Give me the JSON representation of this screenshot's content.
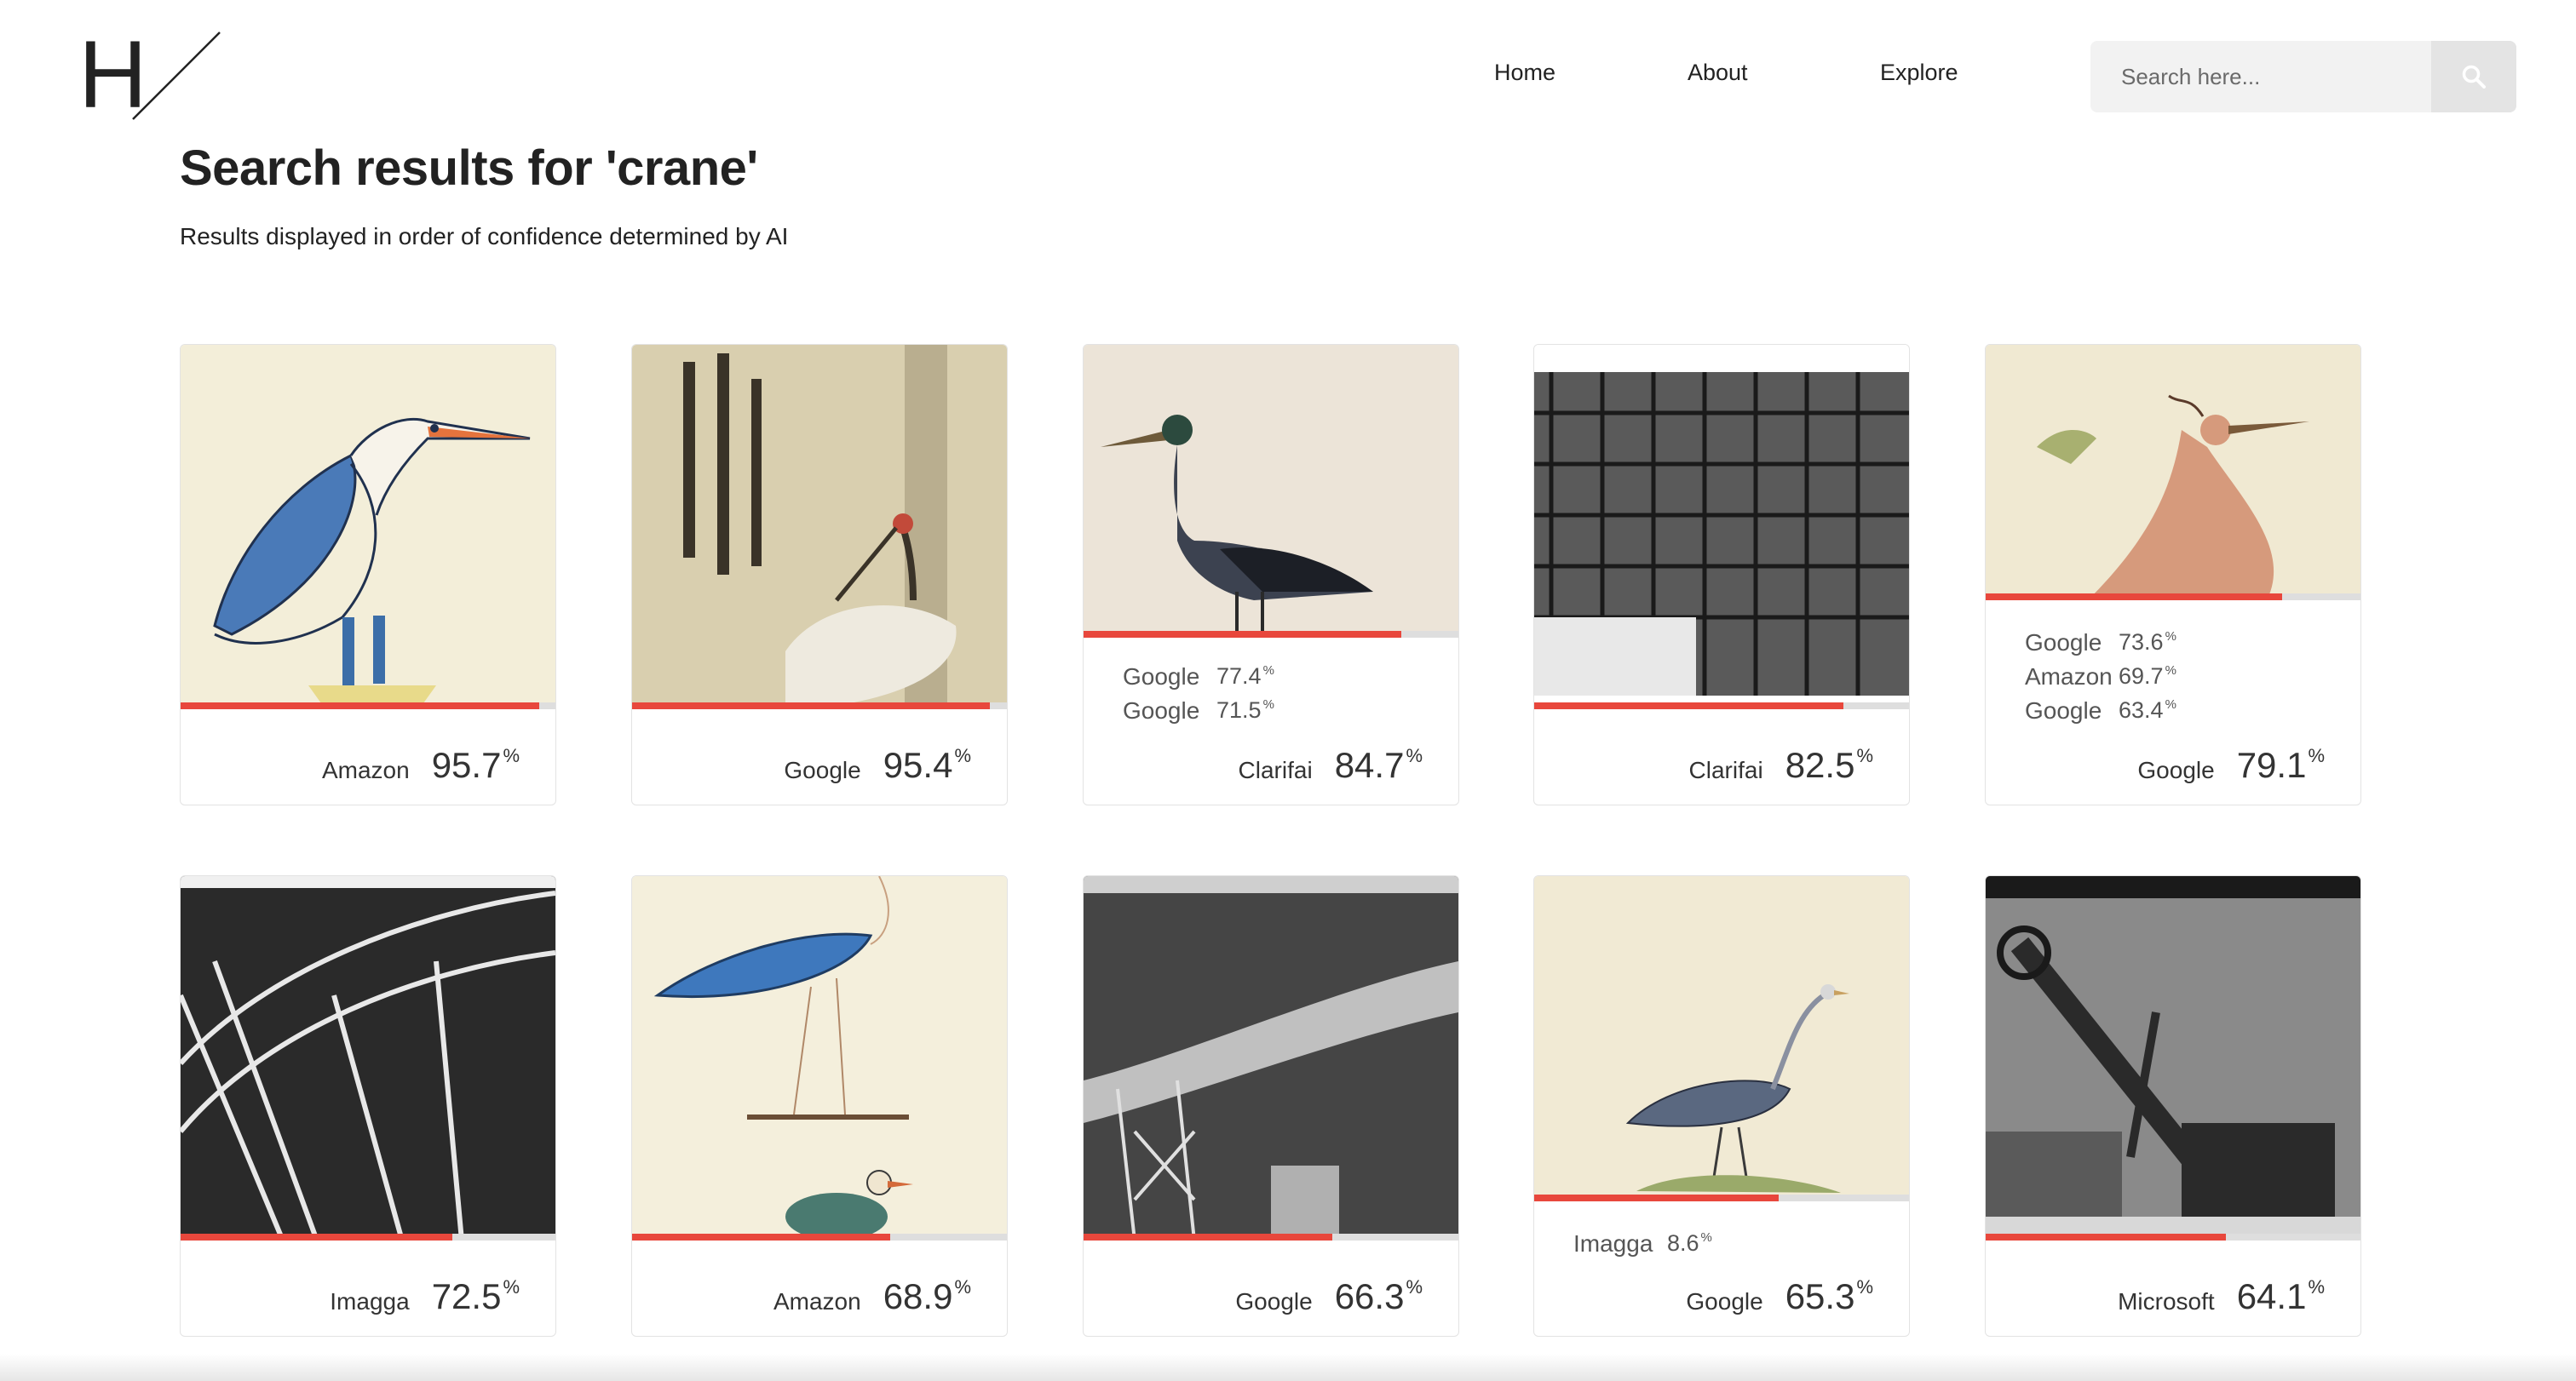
{
  "logo": {
    "letter": "H"
  },
  "nav": {
    "home": "Home",
    "about": "About",
    "explore": "Explore"
  },
  "search": {
    "placeholder": "Search here..."
  },
  "header": {
    "title": "Search results for 'crane'",
    "subtitle": "Results displayed in order of confidence determined by AI"
  },
  "percent_sign": "%",
  "results": [
    {
      "provider": "Amazon",
      "score": "95.7",
      "fill": 0.957,
      "extras": []
    },
    {
      "provider": "Google",
      "score": "95.4",
      "fill": 0.954,
      "extras": []
    },
    {
      "provider": "Clarifai",
      "score": "84.7",
      "fill": 0.847,
      "extras": [
        {
          "provider": "Google",
          "score": "77.4"
        },
        {
          "provider": "Google",
          "score": "71.5"
        }
      ]
    },
    {
      "provider": "Clarifai",
      "score": "82.5",
      "fill": 0.825,
      "extras": []
    },
    {
      "provider": "Google",
      "score": "79.1",
      "fill": 0.791,
      "extras": [
        {
          "provider": "Google",
          "score": "73.6"
        },
        {
          "provider": "Amazon",
          "score": "69.7"
        },
        {
          "provider": "Google",
          "score": "63.4"
        }
      ]
    },
    {
      "provider": "Imagga",
      "score": "72.5",
      "fill": 0.725,
      "extras": []
    },
    {
      "provider": "Amazon",
      "score": "68.9",
      "fill": 0.689,
      "extras": []
    },
    {
      "provider": "Google",
      "score": "66.3",
      "fill": 0.663,
      "extras": []
    },
    {
      "provider": "Google",
      "score": "65.3",
      "fill": 0.653,
      "extras": [
        {
          "provider": "Imagga",
          "score": "8.6"
        }
      ]
    },
    {
      "provider": "Microsoft",
      "score": "64.1",
      "fill": 0.641,
      "extras": []
    }
  ],
  "colors": {
    "accent": "#e8473c",
    "track": "#dedede"
  }
}
